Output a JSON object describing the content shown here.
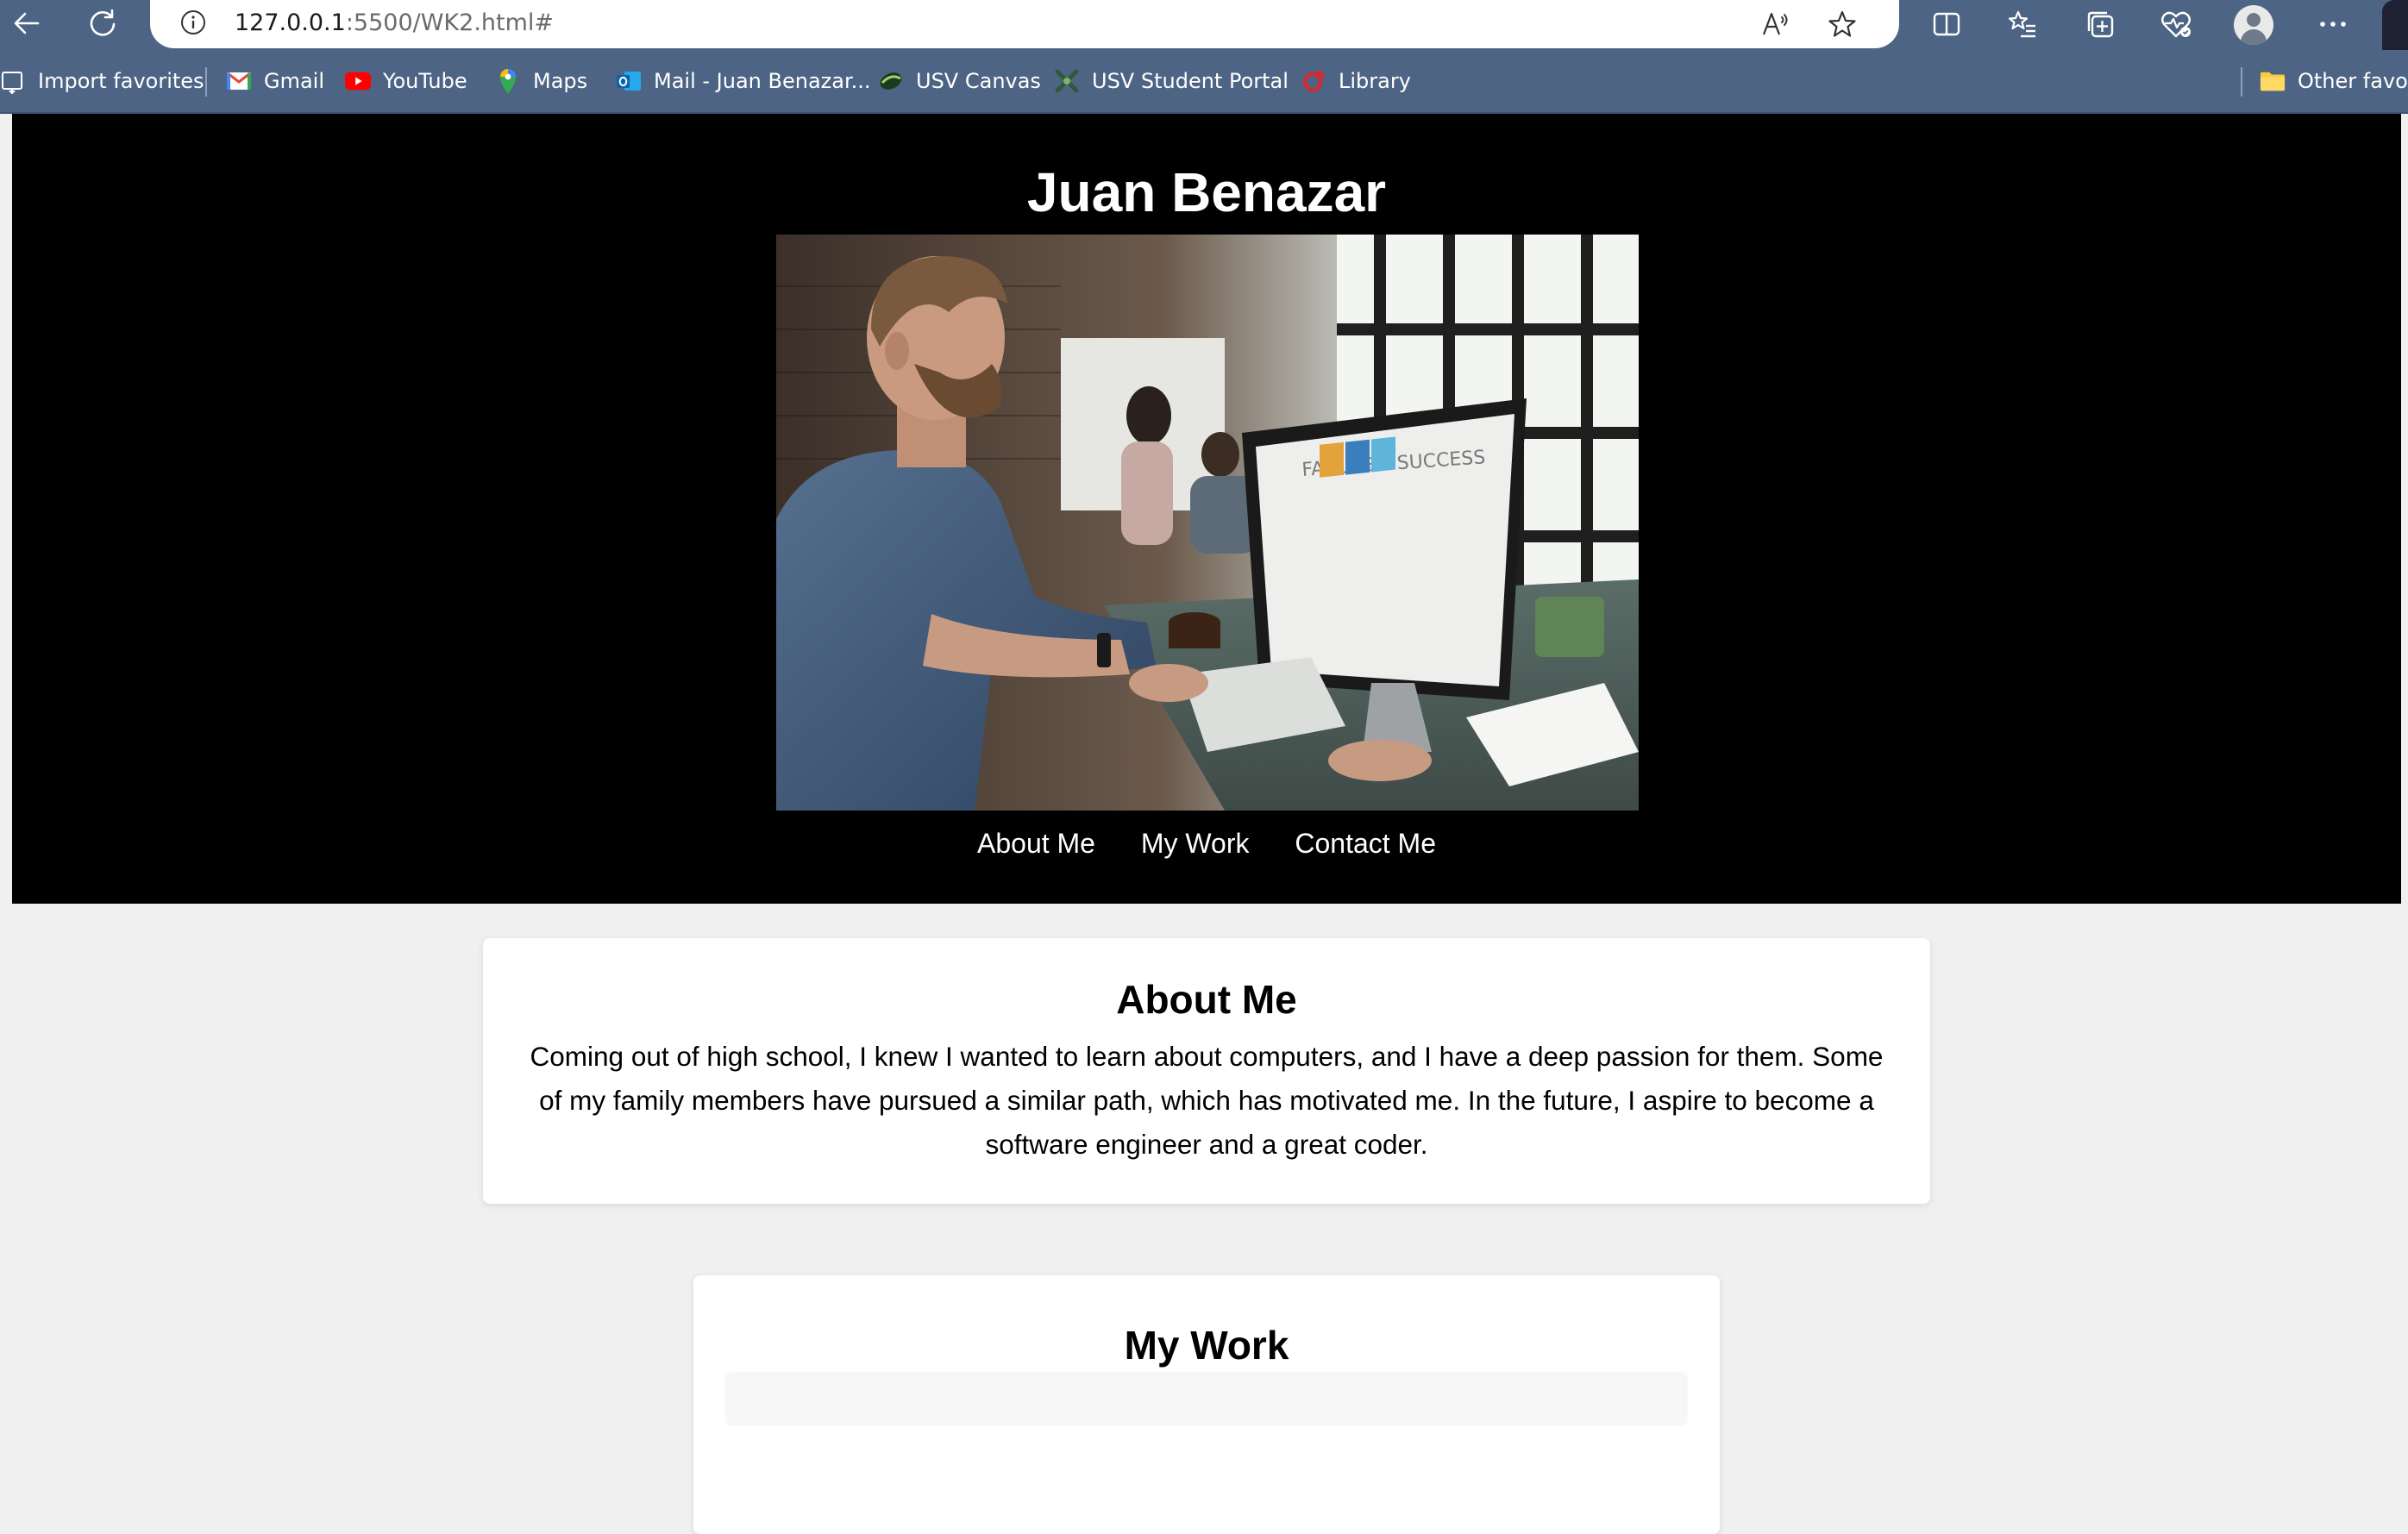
{
  "browser": {
    "url_host": "127.0.0.1",
    "url_path": ":5500/WK2.html#",
    "accent": "#4e6484"
  },
  "bookmarks": {
    "items": [
      {
        "label": "Import favorites",
        "icon": "import-favorites-icon"
      },
      {
        "label": "Gmail",
        "icon": "gmail-icon"
      },
      {
        "label": "YouTube",
        "icon": "youtube-icon"
      },
      {
        "label": "Maps",
        "icon": "maps-icon"
      },
      {
        "label": "Mail - Juan Benazar...",
        "icon": "outlook-mail-icon"
      },
      {
        "label": "USV Canvas",
        "icon": "canvas-icon"
      },
      {
        "label": "USV Student Portal",
        "icon": "student-portal-icon"
      },
      {
        "label": "Library",
        "icon": "library-icon"
      }
    ],
    "other": "Other favori"
  },
  "header": {
    "title": "Juan Benazar",
    "photo_text": "FAILURE - SUCCESS",
    "nav": [
      "About Me",
      "My Work",
      "Contact Me"
    ]
  },
  "about": {
    "heading": "About Me",
    "text": "Coming out of high school, I knew I wanted to learn about computers, and I have a deep passion for them. Some of my family members have pursued a similar path, which has motivated me. In the future, I aspire to become a software engineer and a great coder."
  },
  "work": {
    "heading": "My Work"
  }
}
